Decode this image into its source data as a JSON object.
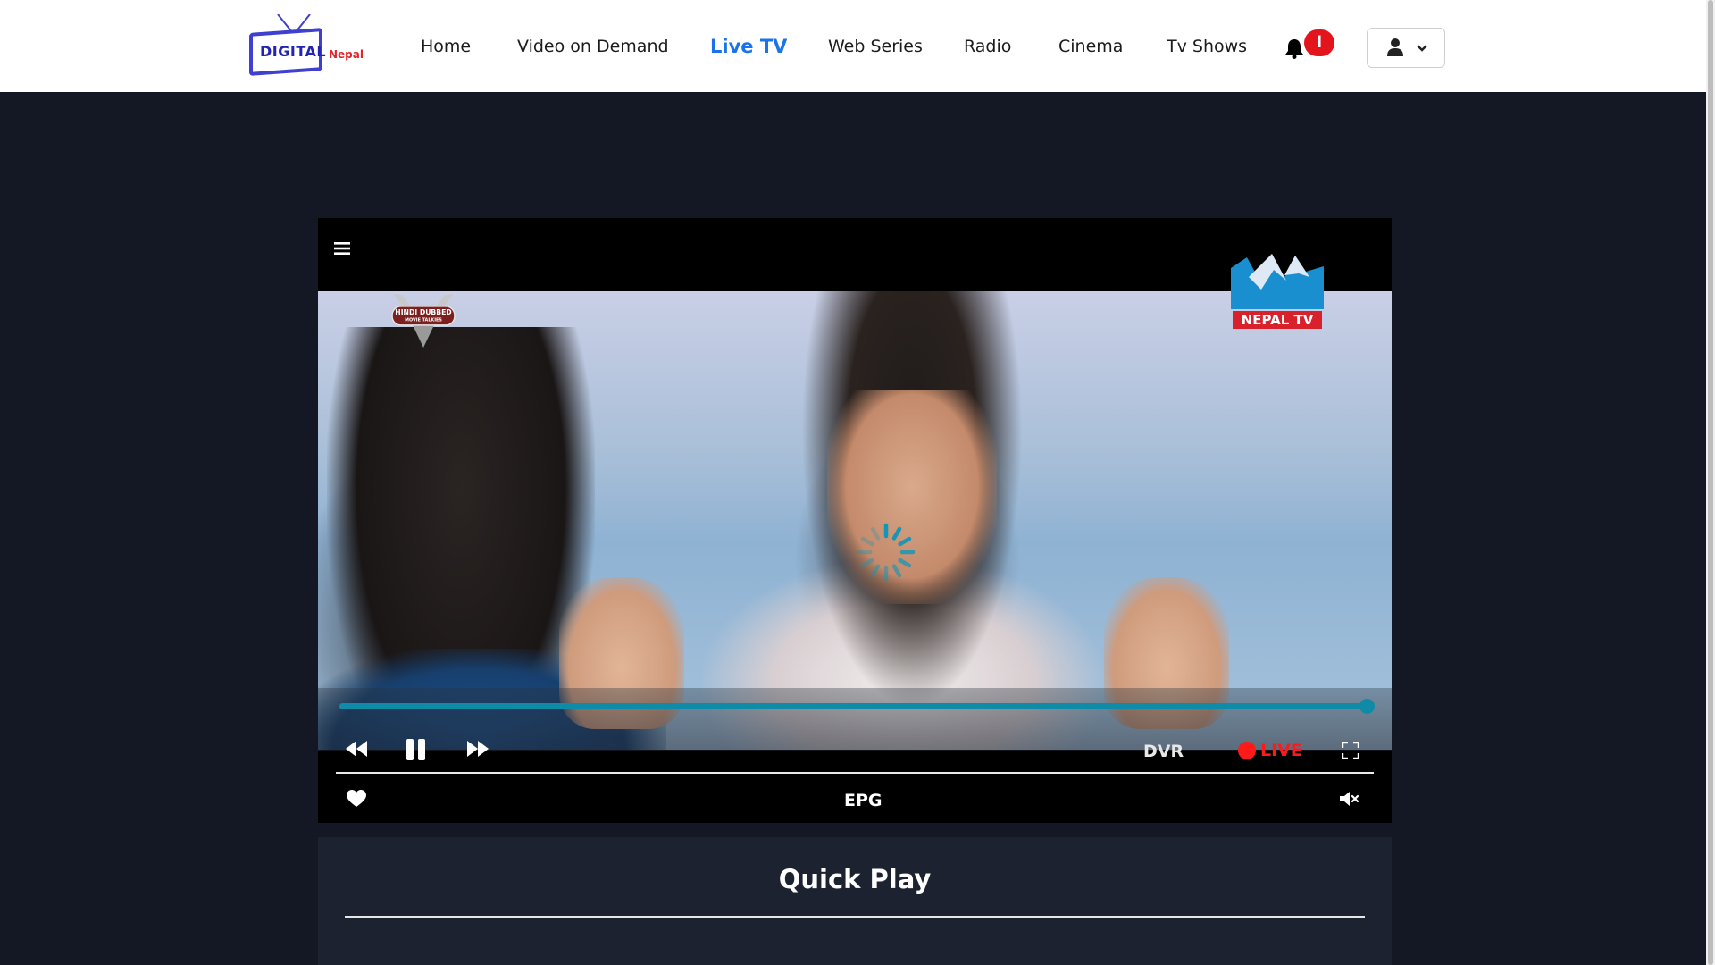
{
  "brand": {
    "logo_main": "DIGITAL",
    "logo_sub": "Nepal",
    "accent": "#1a73e8"
  },
  "nav": {
    "items": [
      {
        "label": "Home",
        "active": false
      },
      {
        "label": "Video on Demand",
        "active": false
      },
      {
        "label": "Live TV",
        "active": true
      },
      {
        "label": "Web Series",
        "active": false
      },
      {
        "label": "Radio",
        "active": false
      },
      {
        "label": "Cinema",
        "active": false
      },
      {
        "label": "Tv Shows",
        "active": false
      }
    ]
  },
  "notifications": {
    "icon": "bell-icon",
    "badge": "i",
    "badge_color": "#e3141b"
  },
  "user_menu": {
    "icon": "user-icon",
    "caret": "chevron-down-icon"
  },
  "player": {
    "channel_logo_left_line1": "HINDI DUBBED",
    "channel_logo_left_line2": "MOVIE TALKIES",
    "channel_logo_right": "NEPAL TV",
    "progress_fraction": 1.0,
    "dvr_label": "DVR",
    "live_label": "LIVE",
    "live_color": "#ff1a1a",
    "epg_label": "EPG",
    "icons": [
      "menu-icon",
      "rewind-icon",
      "pause-icon",
      "fast-forward-icon",
      "fullscreen-icon",
      "heart-icon",
      "mute-icon",
      "loading-spinner-icon"
    ]
  },
  "quick_play": {
    "title": "Quick Play"
  }
}
